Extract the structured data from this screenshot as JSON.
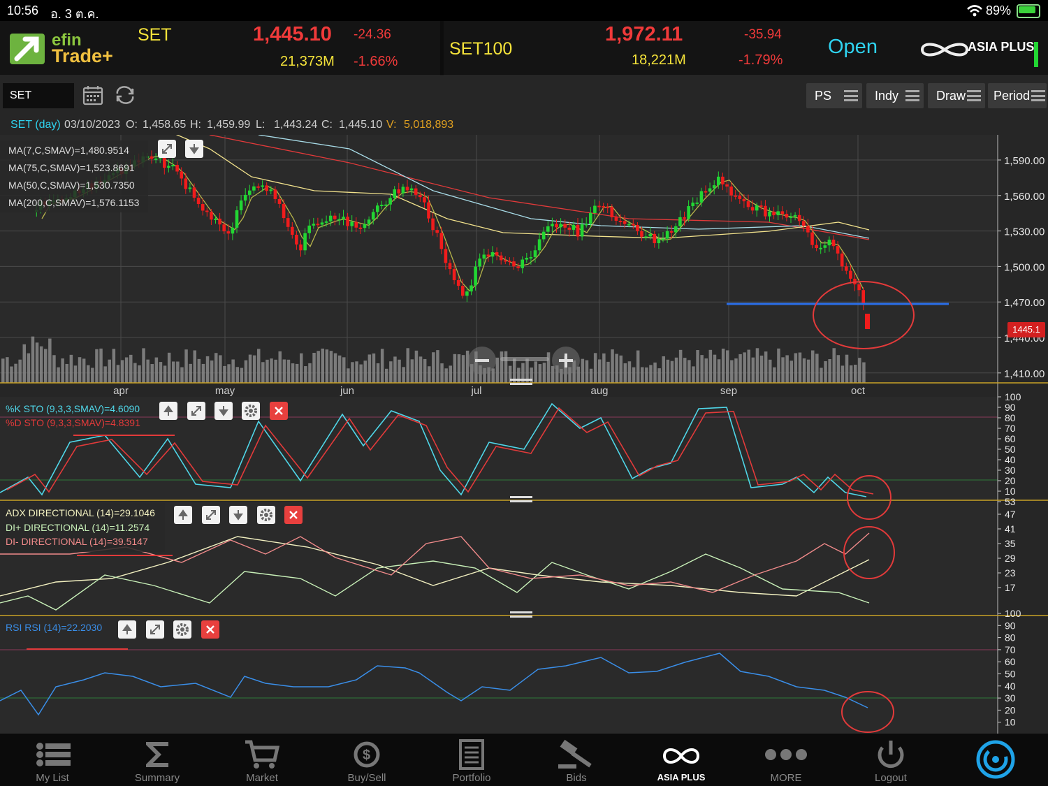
{
  "status_bar": {
    "time": "10:56",
    "date": "อ. 3 ต.ค.",
    "battery": "89%"
  },
  "header": {
    "logo_top": "efin",
    "logo_bottom": "Trade+",
    "index1": {
      "name": "SET",
      "value": "1,445.10",
      "change": "-24.36",
      "volume": "21,373M",
      "percent": "-1.66%"
    },
    "index2": {
      "name": "SET100",
      "value": "1,972.11",
      "change": "-35.94",
      "volume": "18,221M",
      "percent": "-1.79%"
    },
    "market_status": "Open",
    "broker": "ASIA PLUS"
  },
  "toolbar": {
    "symbol": "SET",
    "buttons": [
      "PS",
      "Indy",
      "Draw",
      "Period"
    ]
  },
  "info_line": {
    "symbol": "SET (day)",
    "date": "03/10/2023",
    "o_label": "O:",
    "o": "1,458.65",
    "h_label": "H:",
    "h": "1,459.99",
    "l_label": "L:",
    "l": "1,443.24",
    "c_label": "C:",
    "c": "1,445.10",
    "v_label": "V:",
    "v": "5,018,893"
  },
  "price_panel": {
    "legend": [
      {
        "text": "MA(7,C,SMAV)=1,480.9514",
        "color": "#b5b34a"
      },
      {
        "text": "MA(75,C,SMAV)=1,523.8691",
        "color": "#a8dce8"
      },
      {
        "text": "MA(50,C,SMAV)=1,530.7350",
        "color": "#f2e28c"
      },
      {
        "text": "MA(200,C,SMAV)=1,576.1153",
        "color": "#e23a3a"
      }
    ],
    "y_ticks": [
      "1,590.00",
      "1,560.00",
      "1,530.00",
      "1,500.00",
      "1,470.00",
      "1,440.00",
      "1,410.00"
    ],
    "last_price_tag": "1445.1",
    "months": [
      "apr",
      "may",
      "jun",
      "jul",
      "aug",
      "sep",
      "oct"
    ]
  },
  "sto_panel": {
    "legend": [
      {
        "text": "%K STO (9,3,3,SMAV)=4.6090",
        "color": "#4fd6e8"
      },
      {
        "text": "%D STO (9,3,3,SMAV)=4.8391",
        "color": "#e23a3a"
      }
    ],
    "y_ticks": [
      "100",
      "90",
      "80",
      "70",
      "60",
      "50",
      "40",
      "30",
      "20",
      "10",
      "53"
    ]
  },
  "adx_panel": {
    "legend": [
      {
        "text": "ADX DIRECTIONAL (14)=29.1046",
        "color": "#f2f0c0"
      },
      {
        "text": "DI+ DIRECTIONAL (14)=11.2574",
        "color": "#c8f0b8"
      },
      {
        "text": "DI- DIRECTIONAL (14)=39.5147",
        "color": "#f08a8a"
      }
    ],
    "y_ticks": [
      "47",
      "41",
      "35",
      "29",
      "23",
      "17"
    ]
  },
  "rsi_panel": {
    "legend": [
      {
        "text": "RSI RSI (14)=22.2030",
        "color": "#3a8ee8"
      }
    ],
    "y_ticks": [
      "100",
      "90",
      "80",
      "70",
      "60",
      "50",
      "40",
      "30",
      "20",
      "10"
    ]
  },
  "tabs": [
    "My List",
    "Summary",
    "Market",
    "Buy/Sell",
    "Portfolio",
    "Bids",
    "ASIA PLUS",
    "MORE",
    "Logout"
  ],
  "colors": {
    "up": "#22d633",
    "down": "#f01c1c",
    "accent": "#2fd3f0",
    "header_red": "#f03a3a",
    "header_yellow": "#f5e33a"
  }
}
